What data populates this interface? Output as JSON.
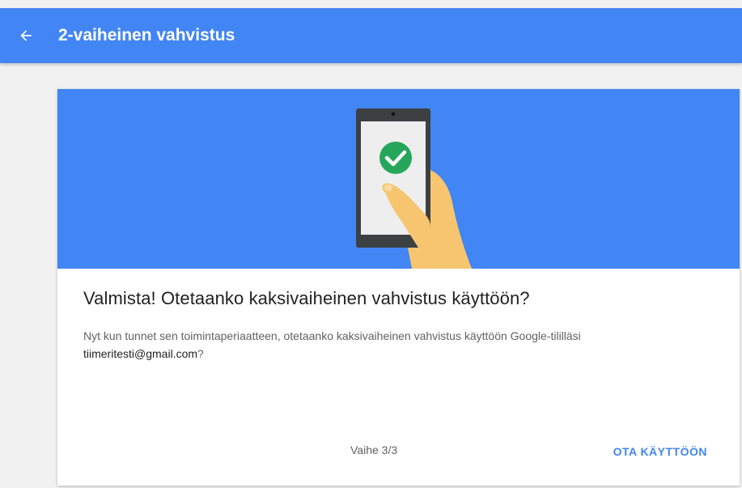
{
  "header": {
    "title": "2-vaiheinen vahvistus",
    "back_icon": "arrow-back-icon",
    "background_color": "#4285f4"
  },
  "card": {
    "hero_color": "#4285f4",
    "title": "Valmista! Otetaanko kaksivaiheinen vahvistus käyttöön?",
    "description_before_email": "Nyt kun tunnet sen toimintaperiaatteen, otetaanko kaksivaiheinen vahvistus käyttöön Google-tililläsi ",
    "email": "tiimeritesti@gmail.com",
    "description_after_email": "?",
    "step_label": "Vaihe 3/3",
    "enable_button_label": "OTA KÄYTTÖÖN",
    "illustration_icons": [
      "phone-icon",
      "checkmark-icon",
      "hand-icon"
    ]
  }
}
